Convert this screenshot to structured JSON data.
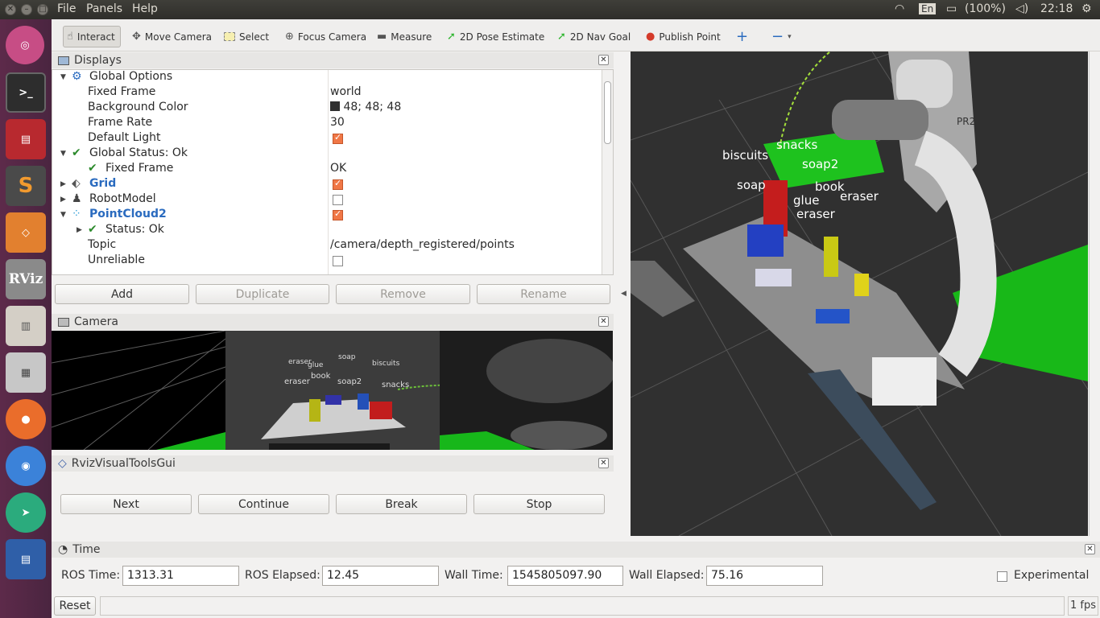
{
  "topbar": {
    "menus": [
      "File",
      "Panels",
      "Help"
    ],
    "keyboard": "En",
    "battery": "(100%)",
    "clock": "22:18"
  },
  "launcher": {
    "items": [
      "ubuntu-icon",
      "terminal-icon",
      "terminator-icon",
      "sublime-icon",
      "gazebo-icon",
      "rviz-icon",
      "files-icon",
      "calculator-icon",
      "firefox-icon",
      "chrome-icon",
      "telegram-icon",
      "writer-icon"
    ],
    "rviz_label": "RViz"
  },
  "toolbar": {
    "tools": [
      "Interact",
      "Move Camera",
      "Select",
      "Focus Camera",
      "Measure",
      "2D Pose Estimate",
      "2D Nav Goal",
      "Publish Point"
    ]
  },
  "displays": {
    "title": "Displays",
    "rows": [
      {
        "label": "Global Options",
        "value": ""
      },
      {
        "label": "Fixed Frame",
        "value": "world"
      },
      {
        "label": "Background Color",
        "value": "48; 48; 48"
      },
      {
        "label": "Frame Rate",
        "value": "30"
      },
      {
        "label": "Default Light",
        "value": ""
      },
      {
        "label": "Global Status: Ok",
        "value": ""
      },
      {
        "label": "Fixed Frame",
        "value": "OK"
      },
      {
        "label": "Grid",
        "value": ""
      },
      {
        "label": "RobotModel",
        "value": ""
      },
      {
        "label": "PointCloud2",
        "value": ""
      },
      {
        "label": "Status: Ok",
        "value": ""
      },
      {
        "label": "Topic",
        "value": "/camera/depth_registered/points"
      },
      {
        "label": "Unreliable",
        "value": ""
      }
    ],
    "buttons": [
      "Add",
      "Duplicate",
      "Remove",
      "Rename"
    ]
  },
  "camera": {
    "title": "Camera",
    "labels": [
      "eraser",
      "glue",
      "soap",
      "biscuits",
      "eraser",
      "book",
      "soap2",
      "snacks"
    ]
  },
  "visual_tools": {
    "title": "RvizVisualToolsGui",
    "buttons": [
      "Next",
      "Continue",
      "Break",
      "Stop"
    ]
  },
  "view3d": {
    "labels": [
      "biscuits",
      "snacks",
      "soap2",
      "soap",
      "book",
      "glue",
      "eraser",
      "eraser",
      "PR2"
    ]
  },
  "time": {
    "title": "Time",
    "ros_time_label": "ROS Time:",
    "ros_time": "1313.31",
    "ros_elapsed_label": "ROS Elapsed:",
    "ros_elapsed": "12.45",
    "wall_time_label": "Wall Time:",
    "wall_time": "1545805097.90",
    "wall_elapsed_label": "Wall Elapsed:",
    "wall_elapsed": "75.16",
    "experimental_label": "Experimental",
    "reset_label": "Reset",
    "fps": "1 fps"
  },
  "colors": {
    "bg_color_swatch": "#303030",
    "accent_checkbox": "#f07746",
    "launcher_bg": "#5d2a4a"
  }
}
